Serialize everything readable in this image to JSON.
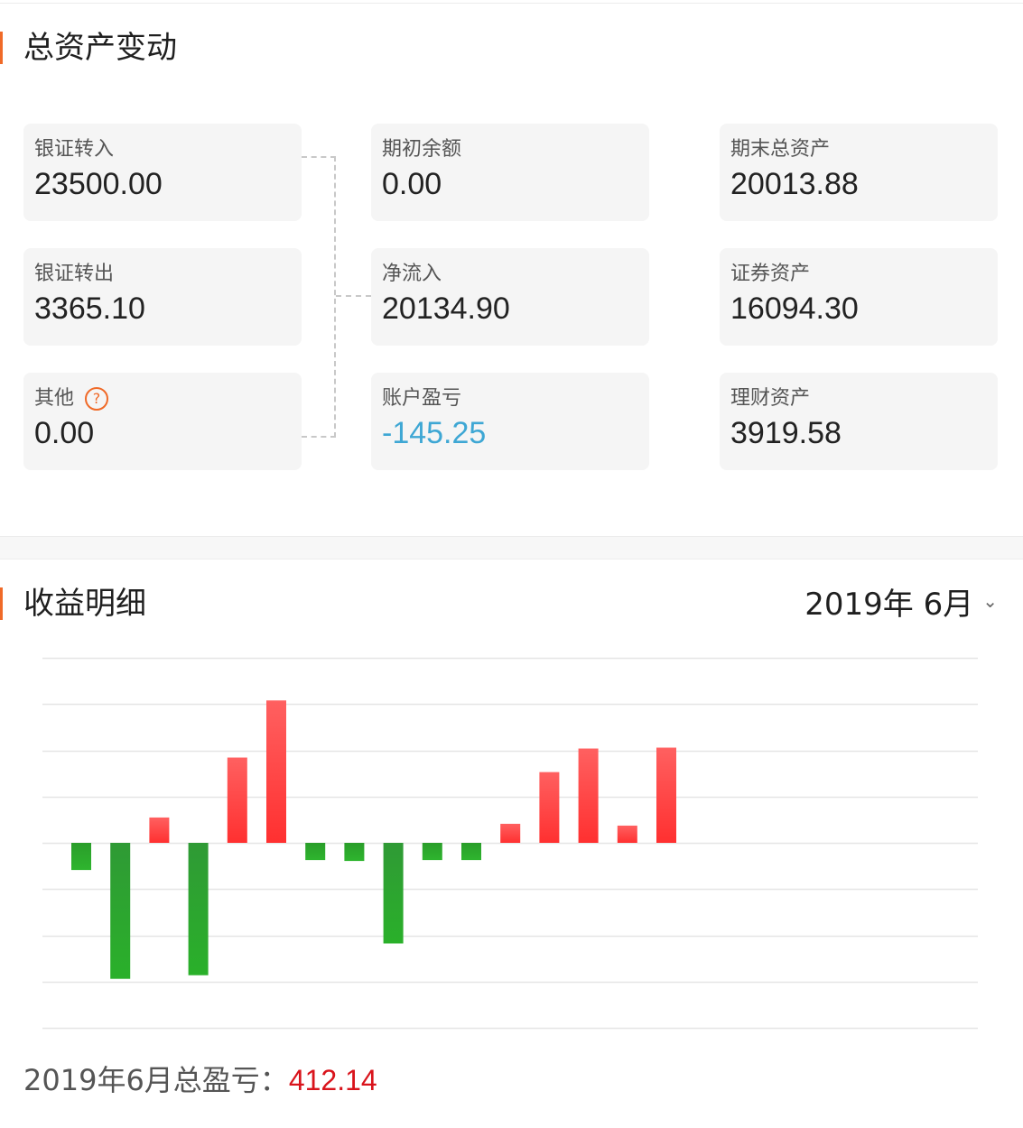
{
  "asset_section": {
    "title": "总资产变动",
    "cards": [
      {
        "id": "bank-in",
        "label": "银证转入",
        "value": "23500.00"
      },
      {
        "id": "bank-out",
        "label": "银证转出",
        "value": "3365.10"
      },
      {
        "id": "other",
        "label": "其他",
        "value": "0.00",
        "help_icon": "question-circle-icon",
        "help_symbol": "?"
      },
      {
        "id": "opening-balance",
        "label": "期初余额",
        "value": "0.00"
      },
      {
        "id": "net-inflow",
        "label": "净流入",
        "value": "20134.90"
      },
      {
        "id": "account-pl",
        "label": "账户盈亏",
        "value": "-145.25"
      },
      {
        "id": "ending-total",
        "label": "期末总资产",
        "value": "20013.88"
      },
      {
        "id": "securities",
        "label": "证券资产",
        "value": "16094.30"
      },
      {
        "id": "wealth",
        "label": "理财资产",
        "value": "3919.58"
      }
    ]
  },
  "income_section": {
    "title": "收益明细",
    "month_selector": {
      "value": "2019年 6月",
      "icon": "chevron-down-icon",
      "icon_symbol": "⌄"
    },
    "total_label": "2019年6月总盈亏：",
    "total_value": "412.14"
  },
  "colors": {
    "accent": "#f06a28",
    "profit": "#ff3030",
    "loss_light": "#2eb52e",
    "loss_dark": "#2f9a35",
    "negative_value": "#3ea7d4",
    "total_value": "#d9141c"
  },
  "chart_data": {
    "type": "bar",
    "series": [
      {
        "values": [
          -30,
          -150,
          28,
          -146,
          94,
          157,
          -19,
          -20,
          -111,
          -19,
          -19,
          21,
          78,
          104,
          19,
          105
        ]
      }
    ],
    "ylim": [
      -204,
      204
    ],
    "grid": true,
    "legend": "none"
  }
}
